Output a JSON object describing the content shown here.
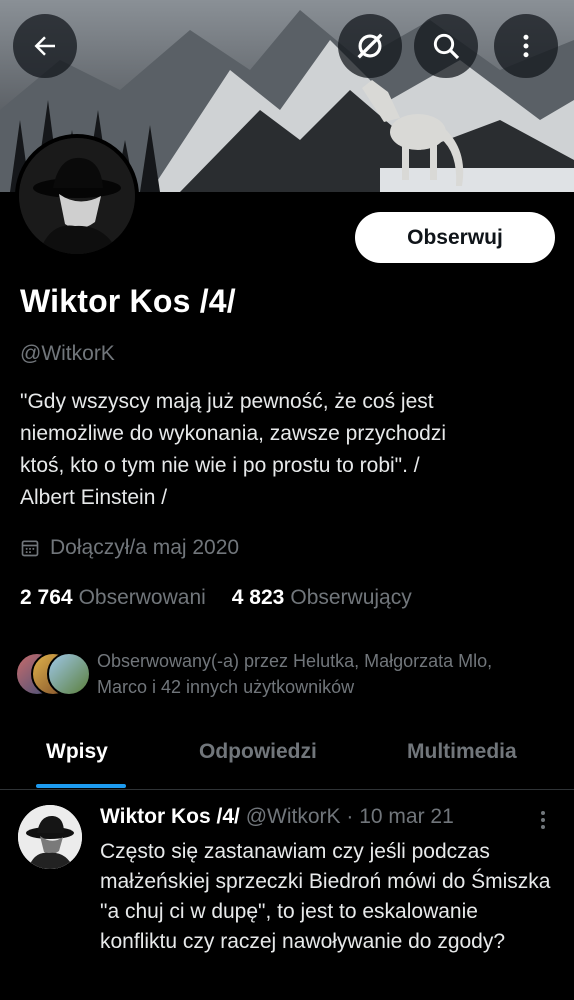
{
  "header": {
    "icons": [
      "arrow-left-icon",
      "grok-icon",
      "search-icon",
      "more-vertical-icon"
    ]
  },
  "profile": {
    "display_name": "Wiktor Kos /4/",
    "handle": "@WitkorK",
    "bio": "\"Gdy wszyscy mają już pewność, że coś jest\nniemożliwe do wykonania, zawsze przychodzi\nktoś, kto o tym nie wie i po prostu to robi\". /\nAlbert Einstein /",
    "joined": "Dołączył/a maj 2020",
    "follow_label": "Obserwuj",
    "following_count": "2 764",
    "following_label": "Obserwowani",
    "followers_count": "4 823",
    "followers_label": "Obserwujący",
    "followed_by": "Obserwowany(-a) przez Helutka, Małgorzata Mlo, Marco i 42 innych użytkowników"
  },
  "tabs": [
    {
      "label": "Wpisy",
      "active": true
    },
    {
      "label": "Odpowiedzi",
      "active": false
    },
    {
      "label": "Multimedia",
      "active": false
    }
  ],
  "tweet": {
    "name": "Wiktor Kos /4/",
    "handle": "@WitkorK",
    "date": "10 mar 21",
    "separator": "·",
    "text": "Często się zastanawiam czy jeśli podczas małżeńskiej sprzeczki Biedroń mówi do Śmiszka \"a chuj ci w dupę\", to jest to eskalowanie konfliktu czy raczej nawoływanie do zgody?"
  },
  "colors": {
    "background": "#000000",
    "accent": "#1d9bf0",
    "secondary_text": "#71767b",
    "primary_text": "#e7e9ea"
  }
}
